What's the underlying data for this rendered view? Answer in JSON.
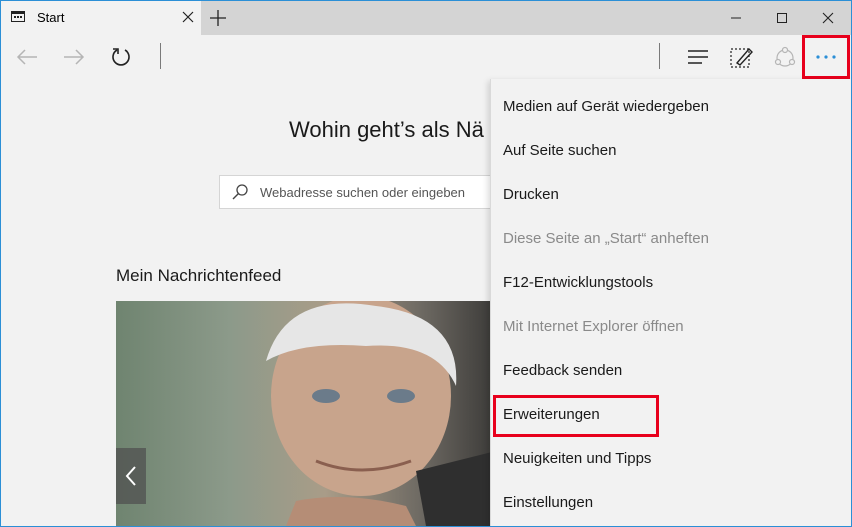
{
  "tab": {
    "title": "Start"
  },
  "colors": {
    "accent": "#2b8fd6",
    "highlight": "#e8001c",
    "disabled": "#8a8a8a"
  },
  "icons": {
    "favicon": "start-page-icon",
    "back": "arrow-left-icon",
    "forward": "arrow-right-icon",
    "refresh": "refresh-icon",
    "hub": "hub-lines-icon",
    "notes": "web-note-icon",
    "share": "share-icon",
    "more": "ellipsis-icon"
  },
  "page": {
    "headline": "Wohin geht’s als Nä",
    "search_placeholder": "Webadresse suchen oder eingeben",
    "feed_title": "Mein Nachrichtenfeed"
  },
  "menu": {
    "items": [
      {
        "label": "Medien auf Gerät wiedergeben",
        "enabled": true
      },
      {
        "label": "Auf Seite suchen",
        "enabled": true
      },
      {
        "label": "Drucken",
        "enabled": true
      },
      {
        "label": "Diese Seite an „Start“ anheften",
        "enabled": false
      },
      {
        "label": "F12-Entwicklungstools",
        "enabled": true
      },
      {
        "label": "Mit Internet Explorer öffnen",
        "enabled": false
      },
      {
        "label": "Feedback senden",
        "enabled": true
      },
      {
        "label": "Erweiterungen",
        "enabled": true,
        "highlighted": true
      },
      {
        "label": "Neuigkeiten und Tipps",
        "enabled": true
      },
      {
        "label": "Einstellungen",
        "enabled": true
      }
    ]
  }
}
